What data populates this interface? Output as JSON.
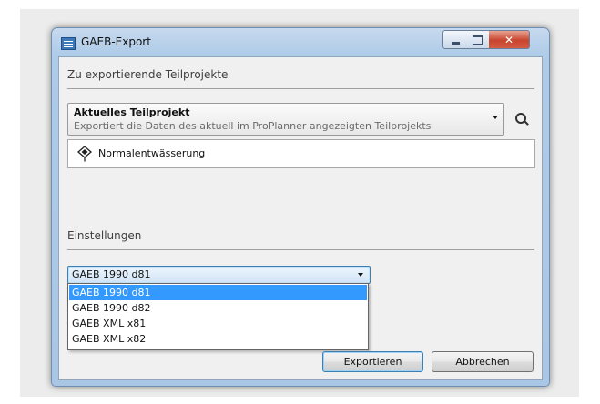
{
  "window": {
    "title": "GAEB-Export",
    "icon": "gaeb-app-icon",
    "controls": {
      "minimize": "minimize-icon",
      "maximize": "maximize-icon",
      "close": "close-icon",
      "close_glyph": "✕"
    }
  },
  "section_projects": {
    "title": "Zu exportierende Teilprojekte",
    "combo": {
      "value": "Aktuelles Teilprojekt",
      "description": "Exportiert die Daten des aktuell im ProPlanner angezeigten Teilprojekts"
    },
    "search_icon": "search-icon",
    "project_item": {
      "icon": "pin-icon",
      "label": "Normalentwässerung"
    }
  },
  "section_settings": {
    "title": "Einstellungen",
    "format_select": {
      "value": "GAEB 1990 d81",
      "options": [
        "GAEB 1990 d81",
        "GAEB 1990 d82",
        "GAEB XML x81",
        "GAEB XML x82"
      ],
      "selected_index": 0
    }
  },
  "buttons": {
    "export": "Exportieren",
    "cancel": "Abbrechen"
  },
  "colors": {
    "selection": "#3399ff",
    "close_button": "#c8452d",
    "frame": "#aecbe8"
  }
}
